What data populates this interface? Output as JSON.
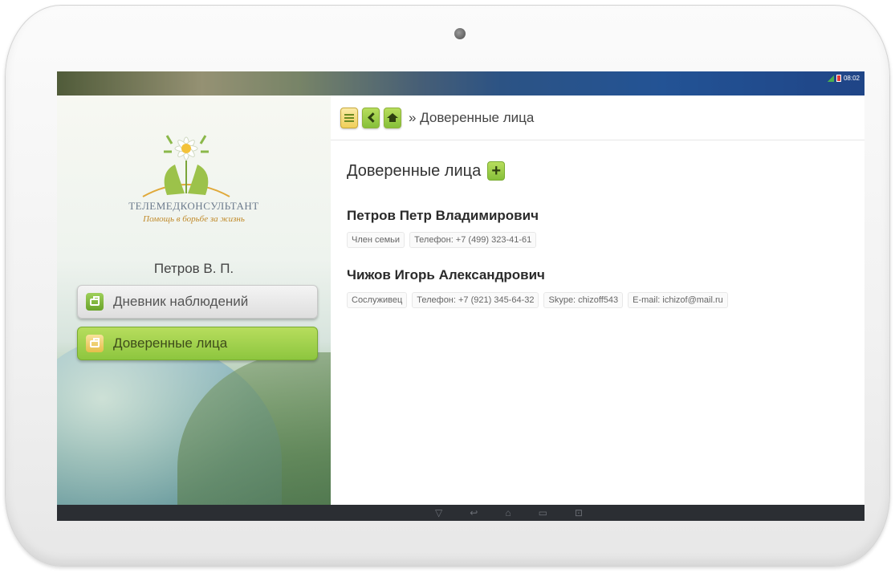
{
  "status_bar": {
    "time": "08:02"
  },
  "sidebar": {
    "brand_name": "ТЕЛЕМЕДКОНСУЛЬТАНТ",
    "brand_slogan": "Помощь в борьбе за жизнь",
    "user_name": "Петров В. П.",
    "menu": [
      {
        "label": "Дневник наблюдений",
        "icon": "briefcase-icon",
        "active": false
      },
      {
        "label": "Доверенные лица",
        "icon": "briefcase-icon",
        "active": true
      }
    ]
  },
  "topbar": {
    "breadcrumb": "» Доверенные лица",
    "buttons": [
      "menu-icon",
      "back-icon",
      "home-icon"
    ]
  },
  "main": {
    "section_title": "Доверенные лица",
    "contacts": [
      {
        "name": "Петров Петр Владимирович",
        "tags": [
          "Член семьи",
          "Телефон: +7 (499) 323-41-61"
        ]
      },
      {
        "name": "Чижов Игорь Александрович",
        "tags": [
          "Сослуживец",
          "Телефон: +7 (921) 345-64-32",
          "Skype: chizoff543",
          "E-mail: ichizof@mail.ru"
        ]
      }
    ]
  },
  "colors": {
    "accent_green": "#8dc63f",
    "accent_yellow": "#f0cf5a"
  }
}
